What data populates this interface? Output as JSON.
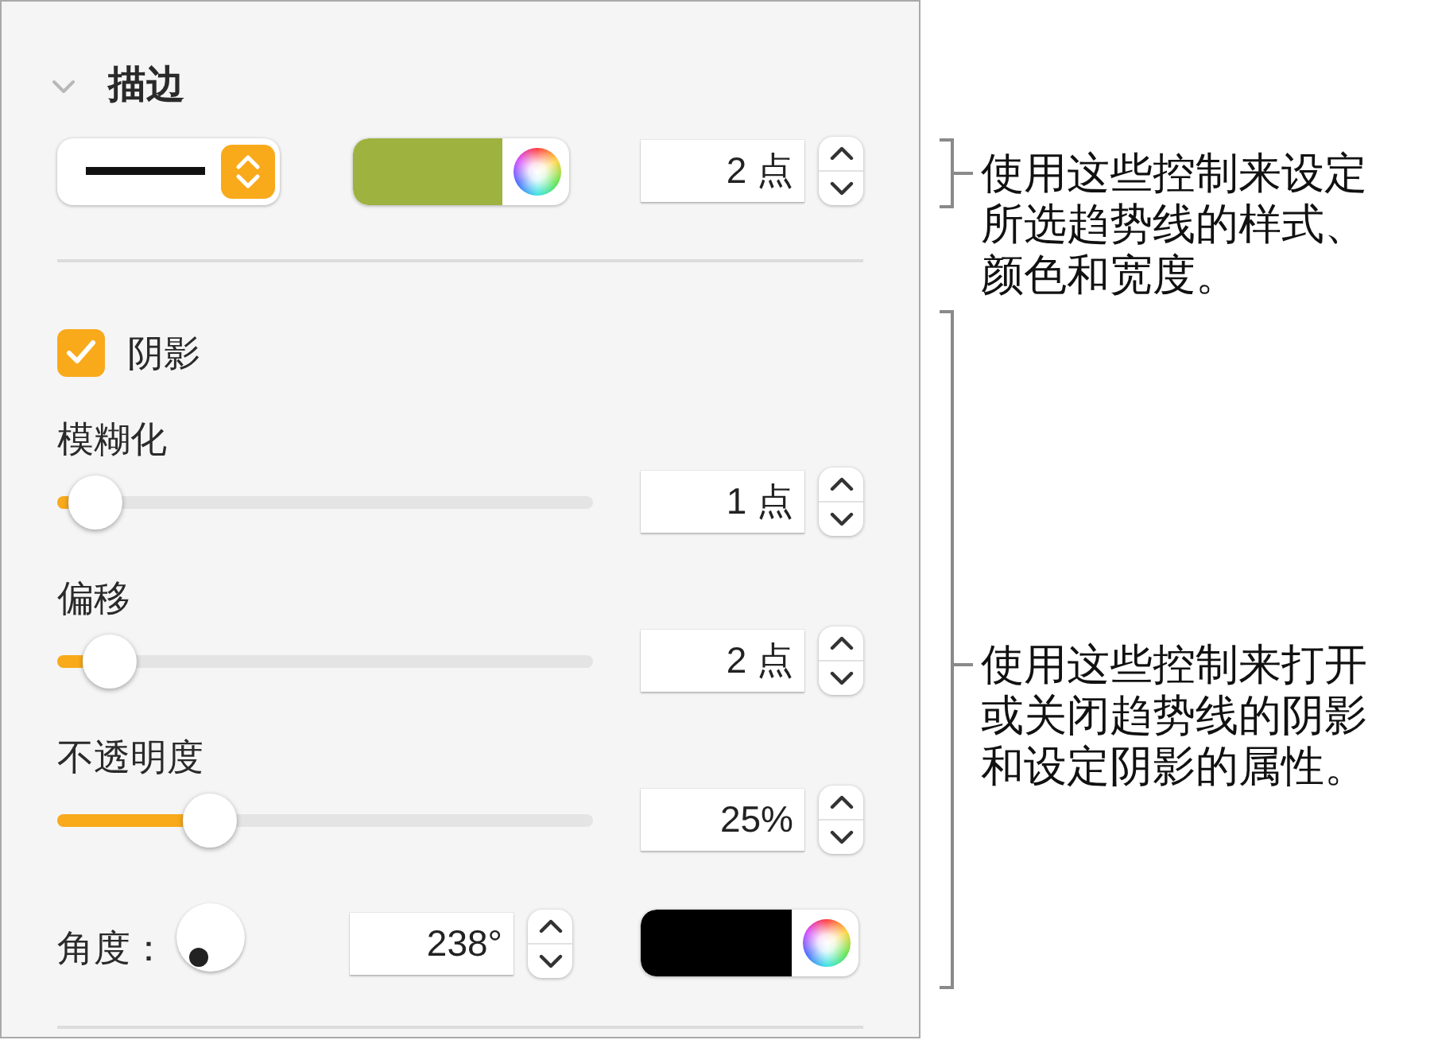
{
  "stroke": {
    "title": "描边",
    "expanded": true,
    "color": "#9db23f",
    "width": "2 点"
  },
  "shadow": {
    "label": "阴影",
    "checked": true,
    "sliders": [
      {
        "label": "模糊化",
        "level": 0.01,
        "value": "1 点"
      },
      {
        "label": "偏移",
        "level": 0.04,
        "value": "2 点"
      },
      {
        "label": "不透明度",
        "level": 0.25,
        "value": "25%"
      }
    ],
    "angle": {
      "label": "角度：",
      "value": "238°"
    },
    "color": "#000000"
  },
  "callouts": [
    "使用这些控制来设定所选趋势线的样式、颜色和宽度。",
    "使用这些控制来打开或关闭趋势线的阴影和设定阴影的属性。"
  ]
}
